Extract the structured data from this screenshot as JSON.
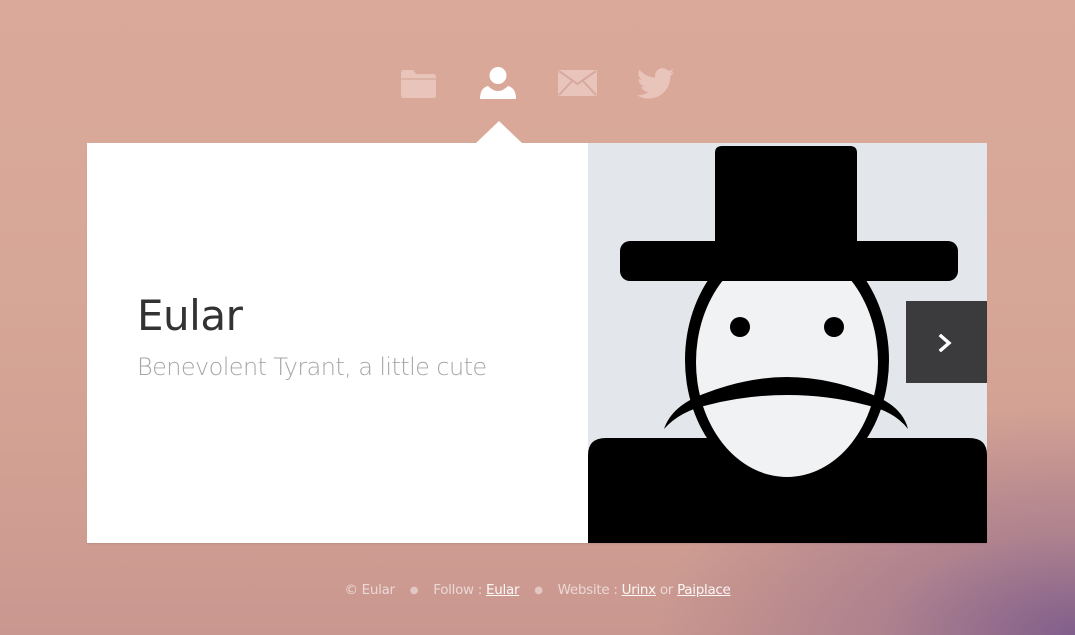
{
  "nav": {
    "items": [
      {
        "icon": "folder-icon"
      },
      {
        "icon": "user-icon",
        "active": true
      },
      {
        "icon": "mail-icon"
      },
      {
        "icon": "twitter-icon"
      }
    ]
  },
  "profile": {
    "name": "Eular",
    "tagline": "Benevolent Tyrant, a little cute",
    "image_icon": "avatar-illustration"
  },
  "next_button": {
    "icon": "chevron-right-icon"
  },
  "footer": {
    "copyright": "© Eular",
    "follow_label": "Follow :",
    "follow_link": "Eular",
    "website_label": "Website :",
    "website_link_1": "Urinx",
    "or_text": "or",
    "website_link_2": "Paiplace"
  },
  "colors": {
    "card_background": "#ffffff",
    "next_button_background": "#3b3b3d",
    "title_color": "#333333",
    "subtitle_color": "#a6a6a6",
    "nav_icon_inactive": "#e7c3b9",
    "nav_icon_active": "#ffffff"
  }
}
